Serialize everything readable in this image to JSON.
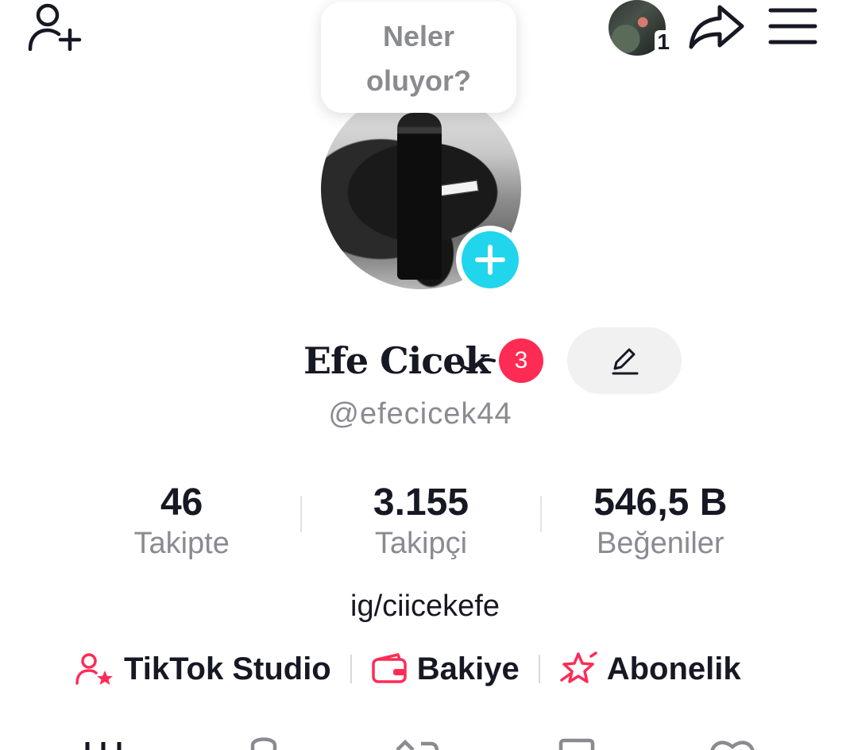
{
  "header": {
    "story_count": "1",
    "icons": [
      "add-friend-icon",
      "share-icon",
      "menu-icon"
    ]
  },
  "bubble": {
    "text": "Neler oluyor?"
  },
  "profile": {
    "name": "Efe Cicek",
    "notification_badge": "3",
    "username": "@efecicek44",
    "bio": "ig/ciicekefe"
  },
  "stats": [
    {
      "value": "46",
      "label": "Takipte"
    },
    {
      "value": "3.155",
      "label": "Takipçi"
    },
    {
      "value": "546,5 B",
      "label": "Beğeniler"
    }
  ],
  "links": [
    {
      "label": "TikTok Studio",
      "icon": "creator-star-icon"
    },
    {
      "label": "Bakiye",
      "icon": "wallet-icon"
    },
    {
      "label": "Abonelik",
      "icon": "subscription-icon"
    }
  ],
  "tabs": [
    "videos-grid-icon",
    "private-lock-icon",
    "repost-icon",
    "saved-icon",
    "liked-heart-icon"
  ],
  "colors": {
    "accent": "#fe2c55",
    "story_add": "#20d5ec",
    "text_primary": "#161823",
    "text_secondary": "#8a8b91"
  }
}
